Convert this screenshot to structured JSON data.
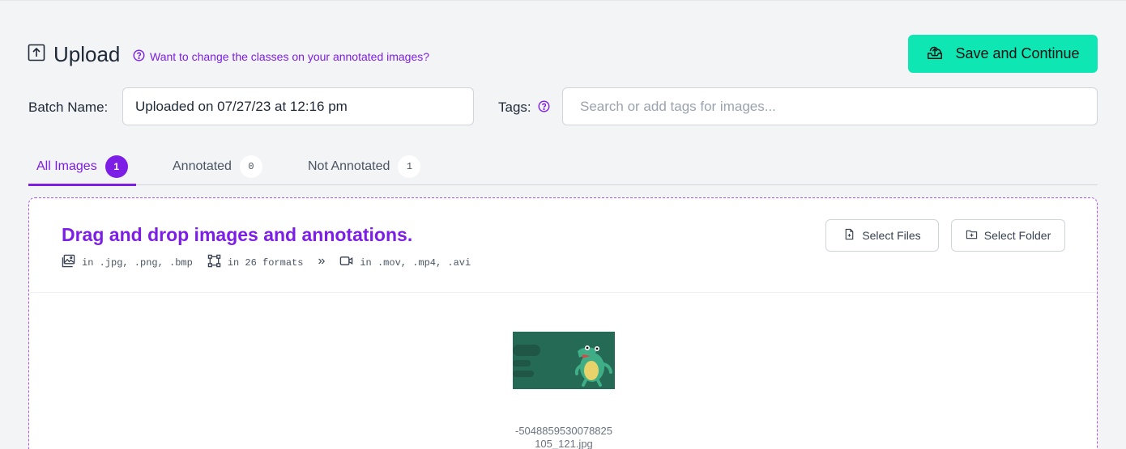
{
  "header": {
    "title": "Upload",
    "help_link": "Want to change the classes on your annotated images?",
    "save_button": "Save and Continue"
  },
  "batch": {
    "label": "Batch Name:",
    "value": "Uploaded on 07/27/23 at 12:16 pm"
  },
  "tags": {
    "label": "Tags:",
    "placeholder": "Search or add tags for images..."
  },
  "tabs": [
    {
      "label": "All Images",
      "count": "1",
      "active": true
    },
    {
      "label": "Annotated",
      "count": "0",
      "active": false
    },
    {
      "label": "Not Annotated",
      "count": "1",
      "active": false
    }
  ],
  "dropzone": {
    "title": "Drag and drop images and annotations.",
    "formats": {
      "images": "in .jpg, .png, .bmp",
      "annotations": "in 26 formats",
      "chevron": "»",
      "videos": "in .mov, .mp4, .avi"
    },
    "select_files": "Select Files",
    "select_folder": "Select Folder"
  },
  "files": [
    {
      "name_line1": "-5048859530078825",
      "name_line2": "105_121.jpg"
    }
  ],
  "colors": {
    "accent": "#7c1ee6",
    "save_button": "#0ee6b3",
    "thumbnail_bg": "#256a55"
  },
  "icons": [
    "upload-box-icon",
    "question-circle-icon",
    "cloud-upload-icon",
    "image-icon",
    "bounding-box-icon",
    "video-icon",
    "file-plus-icon",
    "folder-plus-icon"
  ]
}
